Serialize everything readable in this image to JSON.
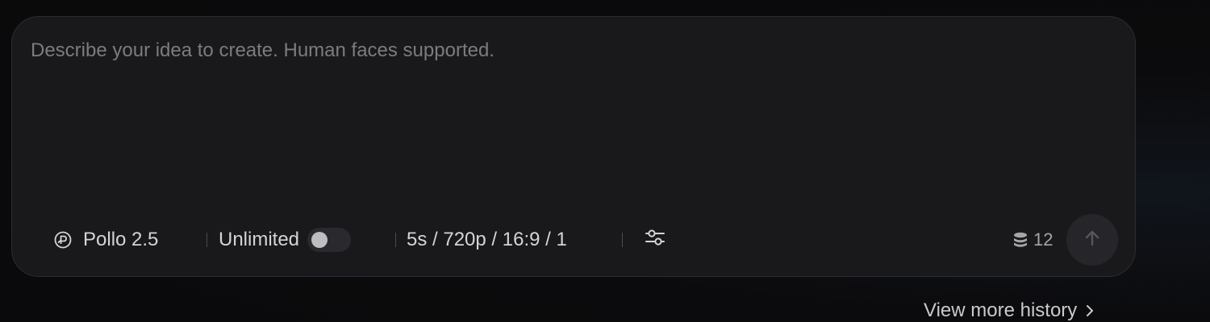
{
  "prompt": {
    "placeholder": "Describe your idea to create. Human faces supported.",
    "value": ""
  },
  "toolbar": {
    "model_label": "Pollo 2.5",
    "model_icon": "pollo-logo-icon",
    "unlimited_label": "Unlimited",
    "unlimited_enabled": false,
    "specs_label": "5s / 720p / 16:9 / 1",
    "settings_icon": "sliders-icon",
    "credits_icon": "coin-stack-icon",
    "credits_count": "12",
    "send_icon": "arrow-up-icon"
  },
  "history": {
    "link_label": "View more history",
    "link_icon": "chevron-right-icon"
  },
  "colors": {
    "background": "#0b0b0d",
    "panel": "#19191b",
    "panel_border": "#2c2c30",
    "placeholder_text": "#7b7b80",
    "toolbar_text": "#d4d4d8",
    "send_button": "#26262a"
  }
}
